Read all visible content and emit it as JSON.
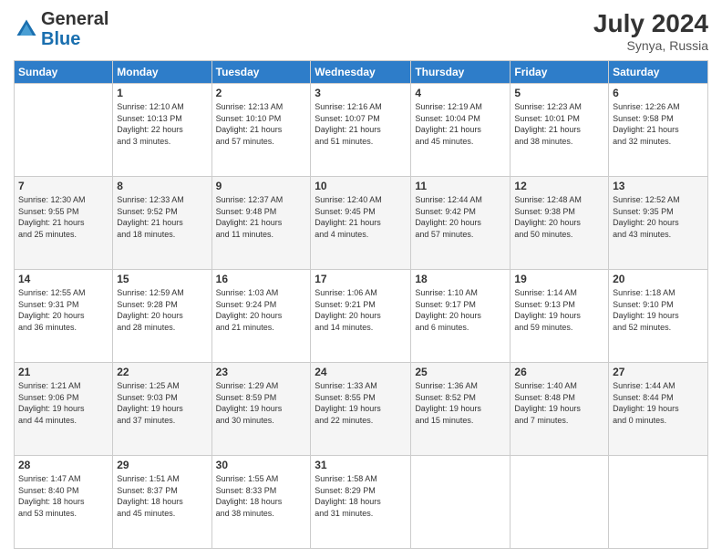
{
  "header": {
    "logo_general": "General",
    "logo_blue": "Blue",
    "month_year": "July 2024",
    "location": "Synya, Russia"
  },
  "columns": [
    "Sunday",
    "Monday",
    "Tuesday",
    "Wednesday",
    "Thursday",
    "Friday",
    "Saturday"
  ],
  "weeks": [
    [
      {
        "day": "",
        "info": ""
      },
      {
        "day": "1",
        "info": "Sunrise: 12:10 AM\nSunset: 10:13 PM\nDaylight: 22 hours\nand 3 minutes."
      },
      {
        "day": "2",
        "info": "Sunrise: 12:13 AM\nSunset: 10:10 PM\nDaylight: 21 hours\nand 57 minutes."
      },
      {
        "day": "3",
        "info": "Sunrise: 12:16 AM\nSunset: 10:07 PM\nDaylight: 21 hours\nand 51 minutes."
      },
      {
        "day": "4",
        "info": "Sunrise: 12:19 AM\nSunset: 10:04 PM\nDaylight: 21 hours\nand 45 minutes."
      },
      {
        "day": "5",
        "info": "Sunrise: 12:23 AM\nSunset: 10:01 PM\nDaylight: 21 hours\nand 38 minutes."
      },
      {
        "day": "6",
        "info": "Sunrise: 12:26 AM\nSunset: 9:58 PM\nDaylight: 21 hours\nand 32 minutes."
      }
    ],
    [
      {
        "day": "7",
        "info": "Sunrise: 12:30 AM\nSunset: 9:55 PM\nDaylight: 21 hours\nand 25 minutes."
      },
      {
        "day": "8",
        "info": "Sunrise: 12:33 AM\nSunset: 9:52 PM\nDaylight: 21 hours\nand 18 minutes."
      },
      {
        "day": "9",
        "info": "Sunrise: 12:37 AM\nSunset: 9:48 PM\nDaylight: 21 hours\nand 11 minutes."
      },
      {
        "day": "10",
        "info": "Sunrise: 12:40 AM\nSunset: 9:45 PM\nDaylight: 21 hours\nand 4 minutes."
      },
      {
        "day": "11",
        "info": "Sunrise: 12:44 AM\nSunset: 9:42 PM\nDaylight: 20 hours\nand 57 minutes."
      },
      {
        "day": "12",
        "info": "Sunrise: 12:48 AM\nSunset: 9:38 PM\nDaylight: 20 hours\nand 50 minutes."
      },
      {
        "day": "13",
        "info": "Sunrise: 12:52 AM\nSunset: 9:35 PM\nDaylight: 20 hours\nand 43 minutes."
      }
    ],
    [
      {
        "day": "14",
        "info": "Sunrise: 12:55 AM\nSunset: 9:31 PM\nDaylight: 20 hours\nand 36 minutes."
      },
      {
        "day": "15",
        "info": "Sunrise: 12:59 AM\nSunset: 9:28 PM\nDaylight: 20 hours\nand 28 minutes."
      },
      {
        "day": "16",
        "info": "Sunrise: 1:03 AM\nSunset: 9:24 PM\nDaylight: 20 hours\nand 21 minutes."
      },
      {
        "day": "17",
        "info": "Sunrise: 1:06 AM\nSunset: 9:21 PM\nDaylight: 20 hours\nand 14 minutes."
      },
      {
        "day": "18",
        "info": "Sunrise: 1:10 AM\nSunset: 9:17 PM\nDaylight: 20 hours\nand 6 minutes."
      },
      {
        "day": "19",
        "info": "Sunrise: 1:14 AM\nSunset: 9:13 PM\nDaylight: 19 hours\nand 59 minutes."
      },
      {
        "day": "20",
        "info": "Sunrise: 1:18 AM\nSunset: 9:10 PM\nDaylight: 19 hours\nand 52 minutes."
      }
    ],
    [
      {
        "day": "21",
        "info": "Sunrise: 1:21 AM\nSunset: 9:06 PM\nDaylight: 19 hours\nand 44 minutes."
      },
      {
        "day": "22",
        "info": "Sunrise: 1:25 AM\nSunset: 9:03 PM\nDaylight: 19 hours\nand 37 minutes."
      },
      {
        "day": "23",
        "info": "Sunrise: 1:29 AM\nSunset: 8:59 PM\nDaylight: 19 hours\nand 30 minutes."
      },
      {
        "day": "24",
        "info": "Sunrise: 1:33 AM\nSunset: 8:55 PM\nDaylight: 19 hours\nand 22 minutes."
      },
      {
        "day": "25",
        "info": "Sunrise: 1:36 AM\nSunset: 8:52 PM\nDaylight: 19 hours\nand 15 minutes."
      },
      {
        "day": "26",
        "info": "Sunrise: 1:40 AM\nSunset: 8:48 PM\nDaylight: 19 hours\nand 7 minutes."
      },
      {
        "day": "27",
        "info": "Sunrise: 1:44 AM\nSunset: 8:44 PM\nDaylight: 19 hours\nand 0 minutes."
      }
    ],
    [
      {
        "day": "28",
        "info": "Sunrise: 1:47 AM\nSunset: 8:40 PM\nDaylight: 18 hours\nand 53 minutes."
      },
      {
        "day": "29",
        "info": "Sunrise: 1:51 AM\nSunset: 8:37 PM\nDaylight: 18 hours\nand 45 minutes."
      },
      {
        "day": "30",
        "info": "Sunrise: 1:55 AM\nSunset: 8:33 PM\nDaylight: 18 hours\nand 38 minutes."
      },
      {
        "day": "31",
        "info": "Sunrise: 1:58 AM\nSunset: 8:29 PM\nDaylight: 18 hours\nand 31 minutes."
      },
      {
        "day": "",
        "info": ""
      },
      {
        "day": "",
        "info": ""
      },
      {
        "day": "",
        "info": ""
      }
    ]
  ]
}
